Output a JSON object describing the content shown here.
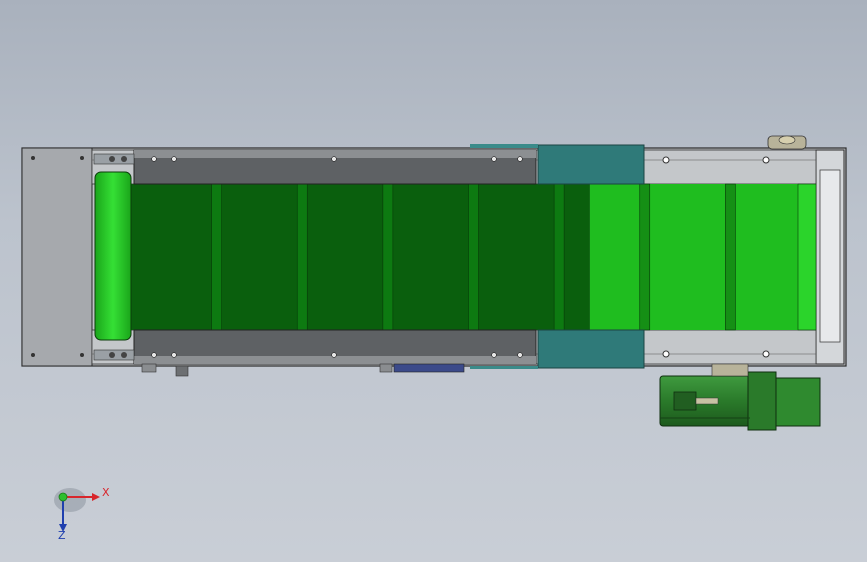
{
  "viewport": {
    "background_top": "#a9b1bd",
    "background_bottom": "#c9ced6"
  },
  "model": {
    "name": "belt-conveyor",
    "belt_section_count": 8,
    "belt_light_fraction": 0.33,
    "colors": {
      "frame": "#bfc2c5",
      "end_plate": "#a6a9ad",
      "guard_rail": "#5e6164",
      "belt_dark": "#0a5f0d",
      "belt_light": "#1fbd1f",
      "roller": "#2bd42b",
      "bracket": "#2f7a79",
      "motor": "#2f7d2f",
      "motor_dark": "#215e21"
    }
  },
  "triad": {
    "x_label": "X",
    "z_label": "Z",
    "x_color": "#d8262c",
    "y_color": "#2fbf2f",
    "z_color": "#1f3fae"
  }
}
